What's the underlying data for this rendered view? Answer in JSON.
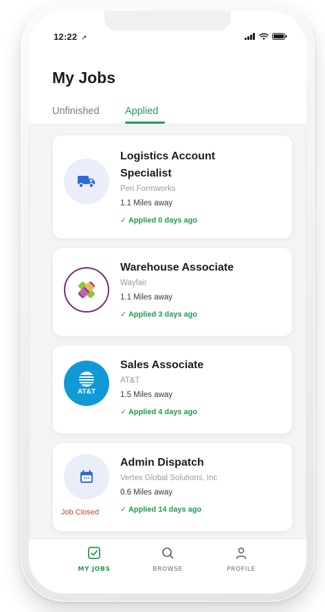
{
  "status_bar": {
    "time": "12:22",
    "location_glyph": "↗"
  },
  "header": {
    "title": "My Jobs",
    "tabs": [
      {
        "label": "Unfinished",
        "active": false
      },
      {
        "label": "Applied",
        "active": true
      }
    ]
  },
  "jobs": [
    {
      "title_line1": "Logistics Account",
      "title_line2": "Specialist",
      "company": "Peri Formworks",
      "distance": "1.1 Miles away",
      "applied": "✓ Applied 0 days ago",
      "icon": "truck-icon"
    },
    {
      "title": "Warehouse Associate",
      "company": "Wayfair",
      "distance": "1.1 Miles away",
      "applied": "✓ Applied 3 days ago",
      "icon": "wayfair-logo"
    },
    {
      "title": "Sales Associate",
      "company": "AT&T",
      "distance": "1.5 Miles away",
      "applied": "✓ Applied 4 days ago",
      "icon": "att-logo",
      "logo_text": "AT&T"
    },
    {
      "title": "Admin Dispatch",
      "company": "Vertex Global Solutions, Inc",
      "distance": "0.6 Miles away",
      "applied": "✓ Applied 14 days ago",
      "status": "Job Closed",
      "icon": "calendar-icon"
    }
  ],
  "bottom_nav": [
    {
      "label": "MY JOBS",
      "icon": "checkbox-icon",
      "active": true
    },
    {
      "label": "BROWSE",
      "icon": "search-icon",
      "active": false
    },
    {
      "label": "PROFILE",
      "icon": "person-icon",
      "active": false
    }
  ],
  "colors": {
    "accent_green": "#1f9a55",
    "closed_red": "#d23a34",
    "icon_blue": "#2f6bd8",
    "att_blue": "#0f9ad6"
  }
}
